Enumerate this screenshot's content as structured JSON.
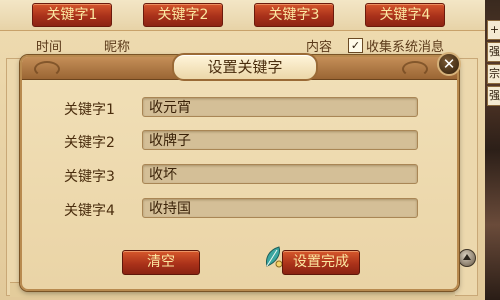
{
  "tabs": [
    {
      "label": "关键字1"
    },
    {
      "label": "关键字2"
    },
    {
      "label": "关键字3"
    },
    {
      "label": "关键字4"
    }
  ],
  "background": {
    "col_time": "时间",
    "col_nickname": "昵称",
    "col_content": "内容",
    "collect_checkbox_label": "收集系统消息",
    "checkbox_checked": true
  },
  "right_art_glyphs": [
    "+",
    "强",
    "宗",
    "强"
  ],
  "dialog": {
    "title": "设置关键字",
    "close_glyph": "✕",
    "rows": [
      {
        "label": "关键字1",
        "value": "收元宵"
      },
      {
        "label": "关键字2",
        "value": "收牌子"
      },
      {
        "label": "关键字3",
        "value": "收坏"
      },
      {
        "label": "关键字4",
        "value": "收持国"
      }
    ],
    "clear_label": "清空",
    "done_label": "设置完成"
  },
  "icons": {
    "close": "close-icon",
    "scroll_up": "scroll-up-icon",
    "leaf": "leaf-icon",
    "checkbox": "checkbox-icon"
  },
  "colors": {
    "tab_red": "#ab321a",
    "tab_text": "#fbe7a1",
    "dialog_bg": "#f1e0b8",
    "input_bg": "#d4bf97",
    "label_text": "#4a2d0e"
  }
}
